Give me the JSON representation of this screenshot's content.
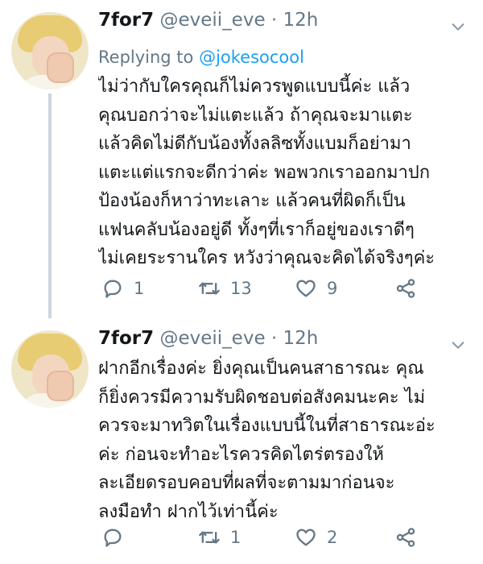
{
  "colors": {
    "link": "#1da1f2",
    "muted": "#657786",
    "text": "#14171a",
    "thread_line": "#ccd6dd"
  },
  "tweets": [
    {
      "display_name": "7for7",
      "handle": "@eveii_eve · 12h",
      "replying_to_label": "Replying to ",
      "replying_to_mention": "@jokesocool",
      "lines": [
        "ไม่ว่ากับใครคุณก็ไม่ควรพูดแบบนี้ค่ะ แล้ว",
        "คุณบอกว่าจะไม่แตะแล้ว ถ้าคุณจะมาแตะ",
        "แล้วคิดไม่ดีกับน้องทั้งลลิซทั้งแบมก็อย่ามา",
        "แตะแต่แรกจะดีกว่าค่ะ พอพวกเราออกมาปก",
        "ป้องน้องก็หาว่าทะเลาะ แล้วคนที่ผิดก็เป็น",
        "แฟนคลับน้องอยู่ดี ทั้งๆที่เราก็อยู่ของเราดีๆ",
        "ไม่เคยระรานใคร หวังว่าคุณจะคิดได้จริงๆค่ะ"
      ],
      "reply_count": "1",
      "retweet_count": "13",
      "like_count": "9",
      "icons": [
        "reply-icon",
        "retweet-icon",
        "heart-icon",
        "share-icon",
        "chevron-down-icon"
      ]
    },
    {
      "display_name": "7for7",
      "handle": "@eveii_eve · 12h",
      "lines": [
        "ฝากอีกเรื่องค่ะ ยิ่งคุณเป็นคนสาธารณะ คุณ",
        "ก็ยิ่งควรมีความรับผิดชอบต่อสังคมนะคะ ไม่",
        "ควรจะมาทวิตในเรื่องแบบนี้ในที่สาธารณะอ่ะ",
        "ค่ะ ก่อนจะทำอะไรควรคิดไตร่ตรองให้",
        "ละเอียดรอบคอบที่ผลที่จะตามมาก่อนจะ",
        "ลงมือทำ ฝากไว้เท่านี้ค่ะ"
      ],
      "reply_count": "",
      "retweet_count": "1",
      "like_count": "2",
      "icons": [
        "reply-icon",
        "retweet-icon",
        "heart-icon",
        "share-icon",
        "chevron-down-icon"
      ]
    }
  ]
}
